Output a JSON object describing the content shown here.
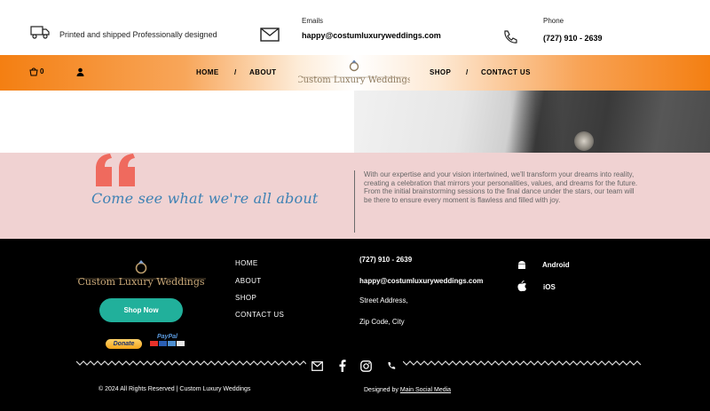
{
  "topbar": {
    "tagline": "Printed and shipped Professionally designed",
    "emails_label": "Emails",
    "email": "happy@costumluxuryweddings.com",
    "phone_label": "Phone",
    "phone": "(727) 910 - 2639"
  },
  "nav": {
    "cart_count": "0",
    "items": [
      "HOME",
      "/",
      "ABOUT",
      "SHOP",
      "/",
      "CONTACT US"
    ],
    "logo_text": "Custom Luxury Weddings"
  },
  "band": {
    "heading": "Come see what we're all about",
    "text": "With our expertise and your vision intertwined, we'll transform your dreams into reality, creating a celebration that mirrors your personalities, values, and dreams for the future. From the initial brainstorming sessions to the final dance under the stars, our team will be there to ensure every moment is flawless and filled with joy."
  },
  "footer": {
    "logo_text": "Custom Luxury Weddings",
    "shop_button": "Shop Now",
    "donate": "Donate",
    "paypal": "PayPal",
    "links": [
      "HOME",
      "ABOUT",
      "SHOP",
      "CONTACT US"
    ],
    "phone": "(727) 910 - 2639",
    "email": "happy@costumluxuryweddings.com",
    "address": "Street Address,",
    "zip": "Zip Code,  City",
    "apps": [
      "Android",
      "iOS"
    ],
    "copyright": "© 2024 All Rights Reserved | Custom Luxury Weddings",
    "designed_by": "Designed by",
    "designer_link": "Main Social Media"
  },
  "colors": {
    "nav_orange": "#f47f12",
    "quote_pink": "#f0d2d2",
    "quote_mark": "#ef6a5e",
    "script_blue": "#3e82b4",
    "shop_teal": "#21b09b",
    "logo_gold": "#b89a6a"
  },
  "icons": [
    "truck-icon",
    "mail-icon",
    "phone-icon",
    "cart-icon",
    "user-icon",
    "android-icon",
    "apple-icon",
    "envelope-icon",
    "facebook-icon",
    "instagram-icon",
    "phone-small-icon"
  ]
}
